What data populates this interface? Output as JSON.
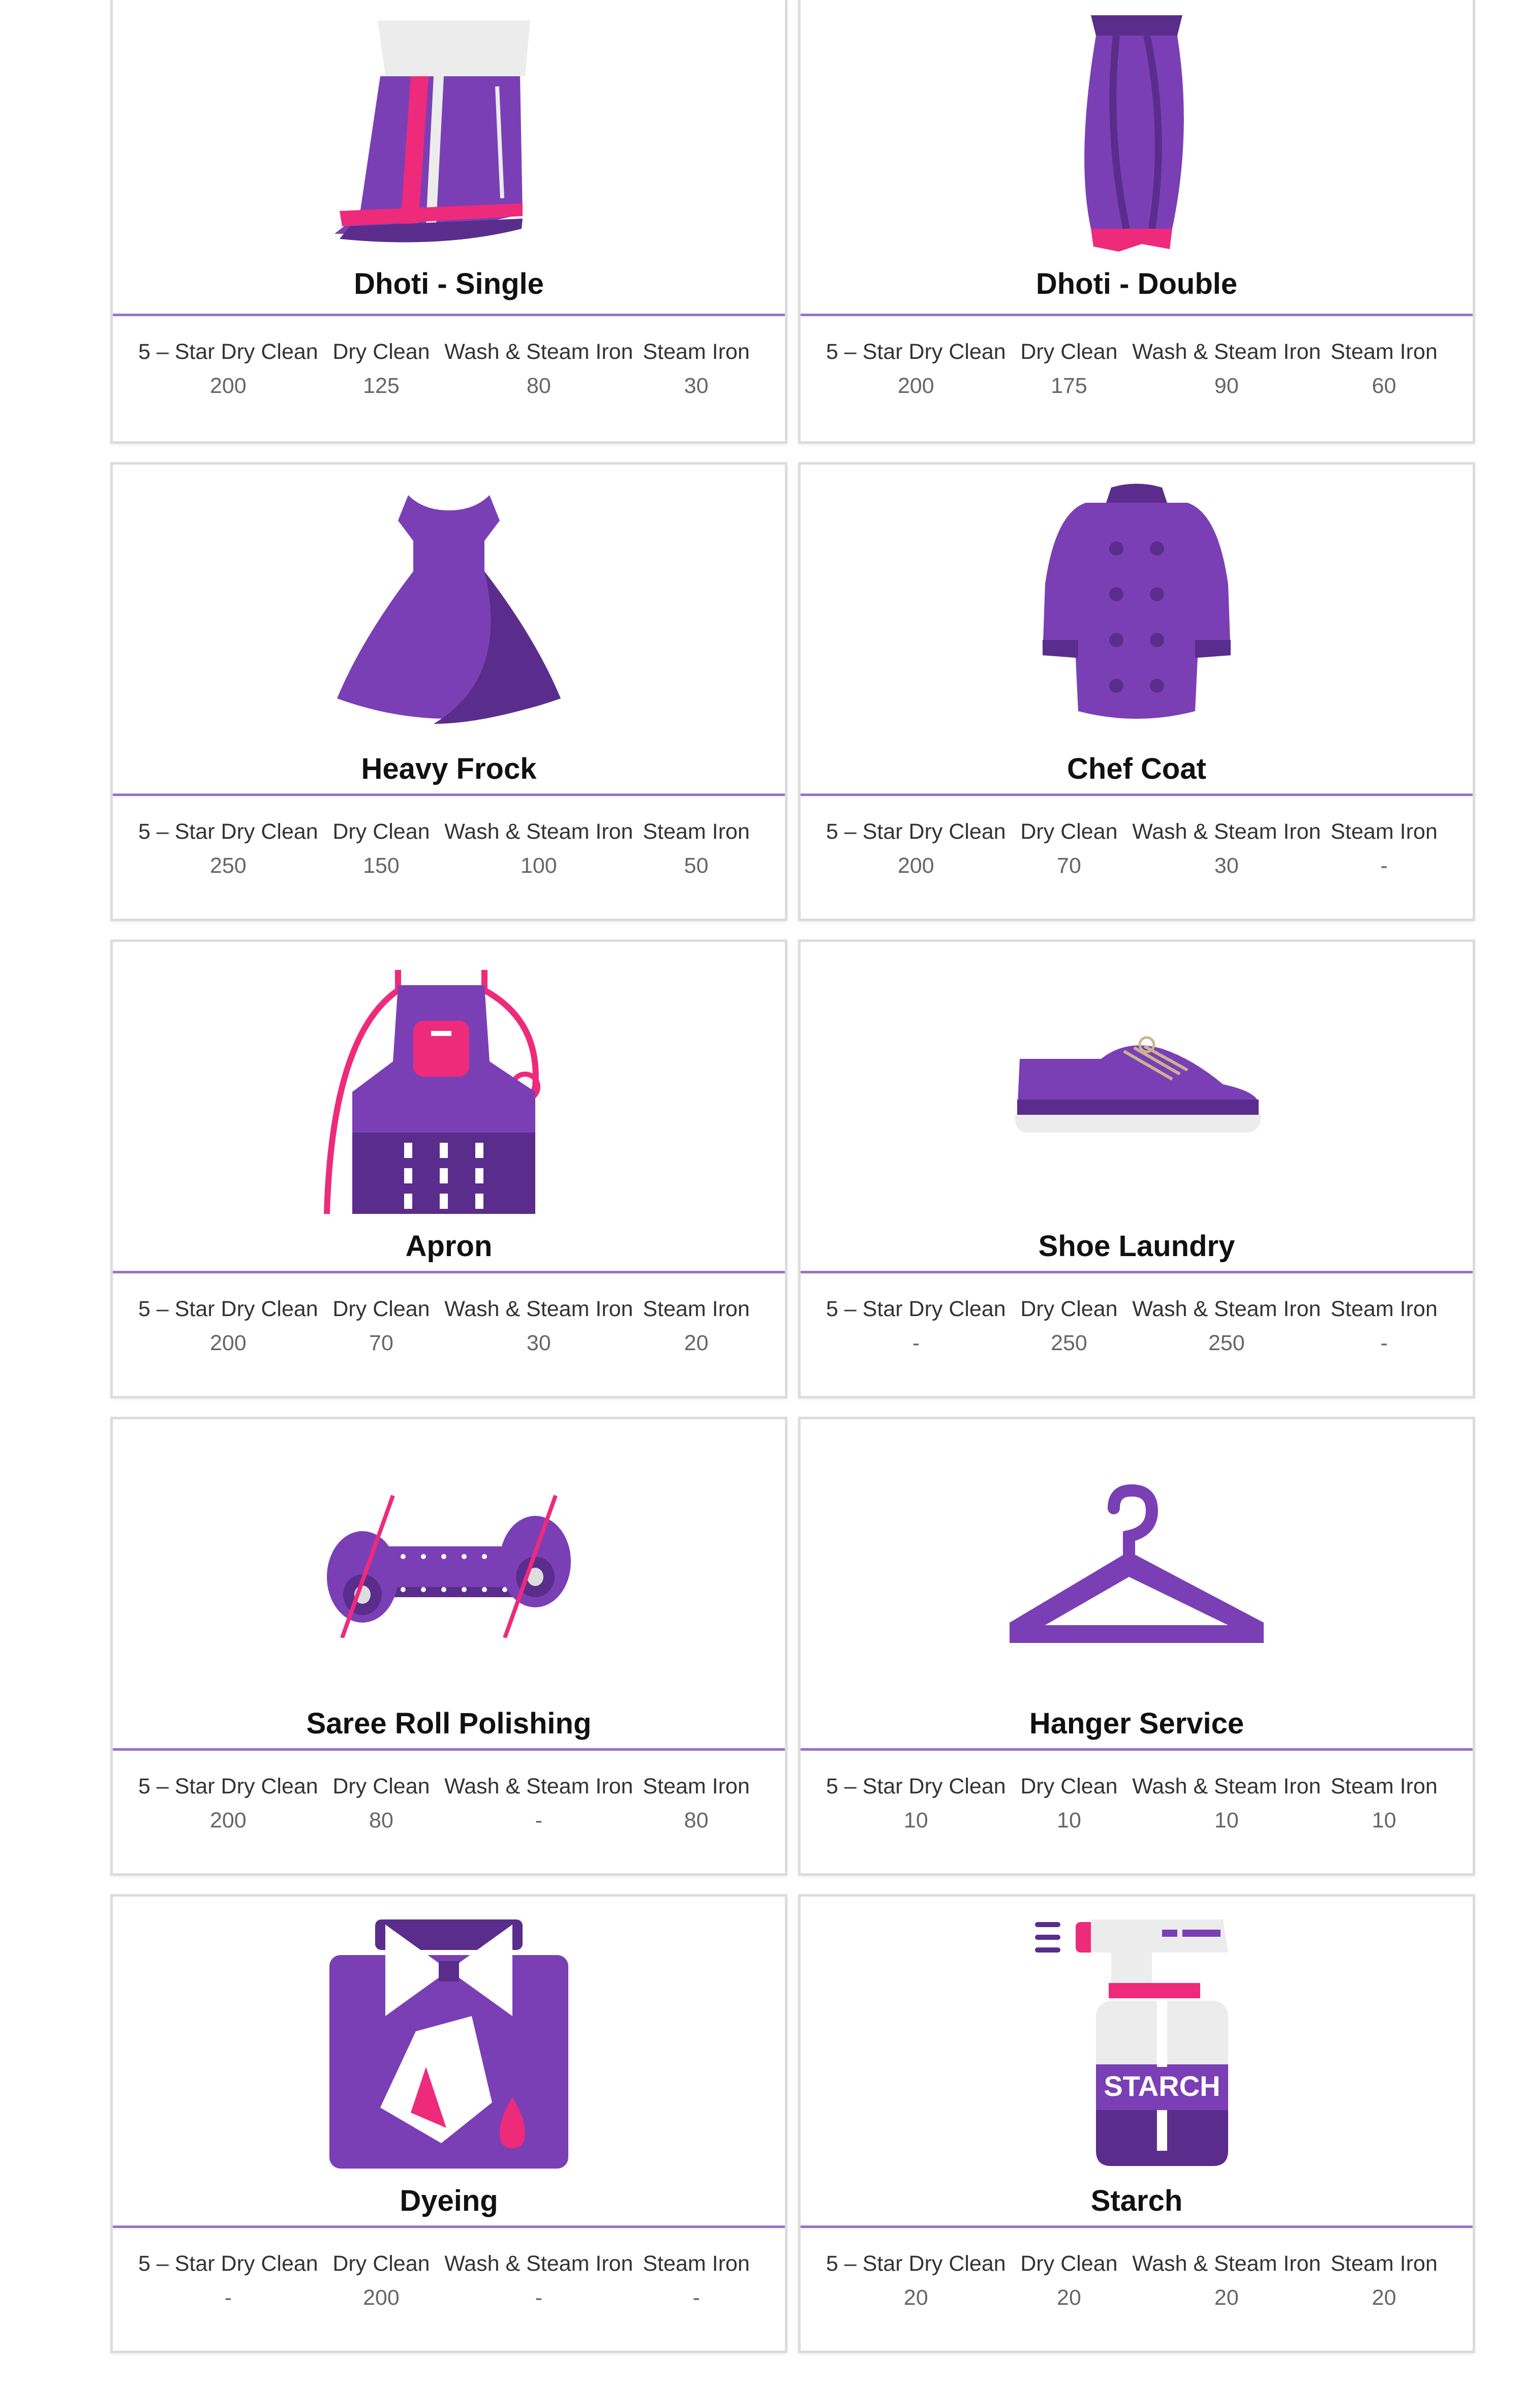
{
  "colors": {
    "purple": "#7b3fb5",
    "dark_purple": "#5a2d8c",
    "pink": "#ee2a7b",
    "rule": "#9b6fca"
  },
  "price_headers": [
    "5 – Star Dry Clean",
    "Dry Clean",
    "Wash & Steam Iron",
    "Steam Iron"
  ],
  "items": [
    {
      "name": "Dhoti - Single",
      "icon": "dhoti-single-icon",
      "prices": [
        "200",
        "125",
        "80",
        "30"
      ]
    },
    {
      "name": "Dhoti - Double",
      "icon": "dhoti-double-icon",
      "prices": [
        "200",
        "175",
        "90",
        "60"
      ]
    },
    {
      "name": "Heavy Frock",
      "icon": "frock-icon",
      "prices": [
        "250",
        "150",
        "100",
        "50"
      ]
    },
    {
      "name": "Chef Coat",
      "icon": "chef-coat-icon",
      "prices": [
        "200",
        "70",
        "30",
        "-"
      ]
    },
    {
      "name": "Apron",
      "icon": "apron-icon",
      "prices": [
        "200",
        "70",
        "30",
        "20"
      ]
    },
    {
      "name": "Shoe Laundry",
      "icon": "shoe-icon",
      "prices": [
        "-",
        "250",
        "250",
        "-"
      ]
    },
    {
      "name": "Saree Roll Polishing",
      "icon": "saree-roll-icon",
      "prices": [
        "200",
        "80",
        "-",
        "80"
      ]
    },
    {
      "name": "Hanger Service",
      "icon": "hanger-icon",
      "prices": [
        "10",
        "10",
        "10",
        "10"
      ]
    },
    {
      "name": "Dyeing",
      "icon": "dyeing-icon",
      "prices": [
        "-",
        "200",
        "-",
        "-"
      ]
    },
    {
      "name": "Starch",
      "icon": "starch-bottle-icon",
      "prices": [
        "20",
        "20",
        "20",
        "20"
      ]
    }
  ],
  "starch_label": "STARCH"
}
